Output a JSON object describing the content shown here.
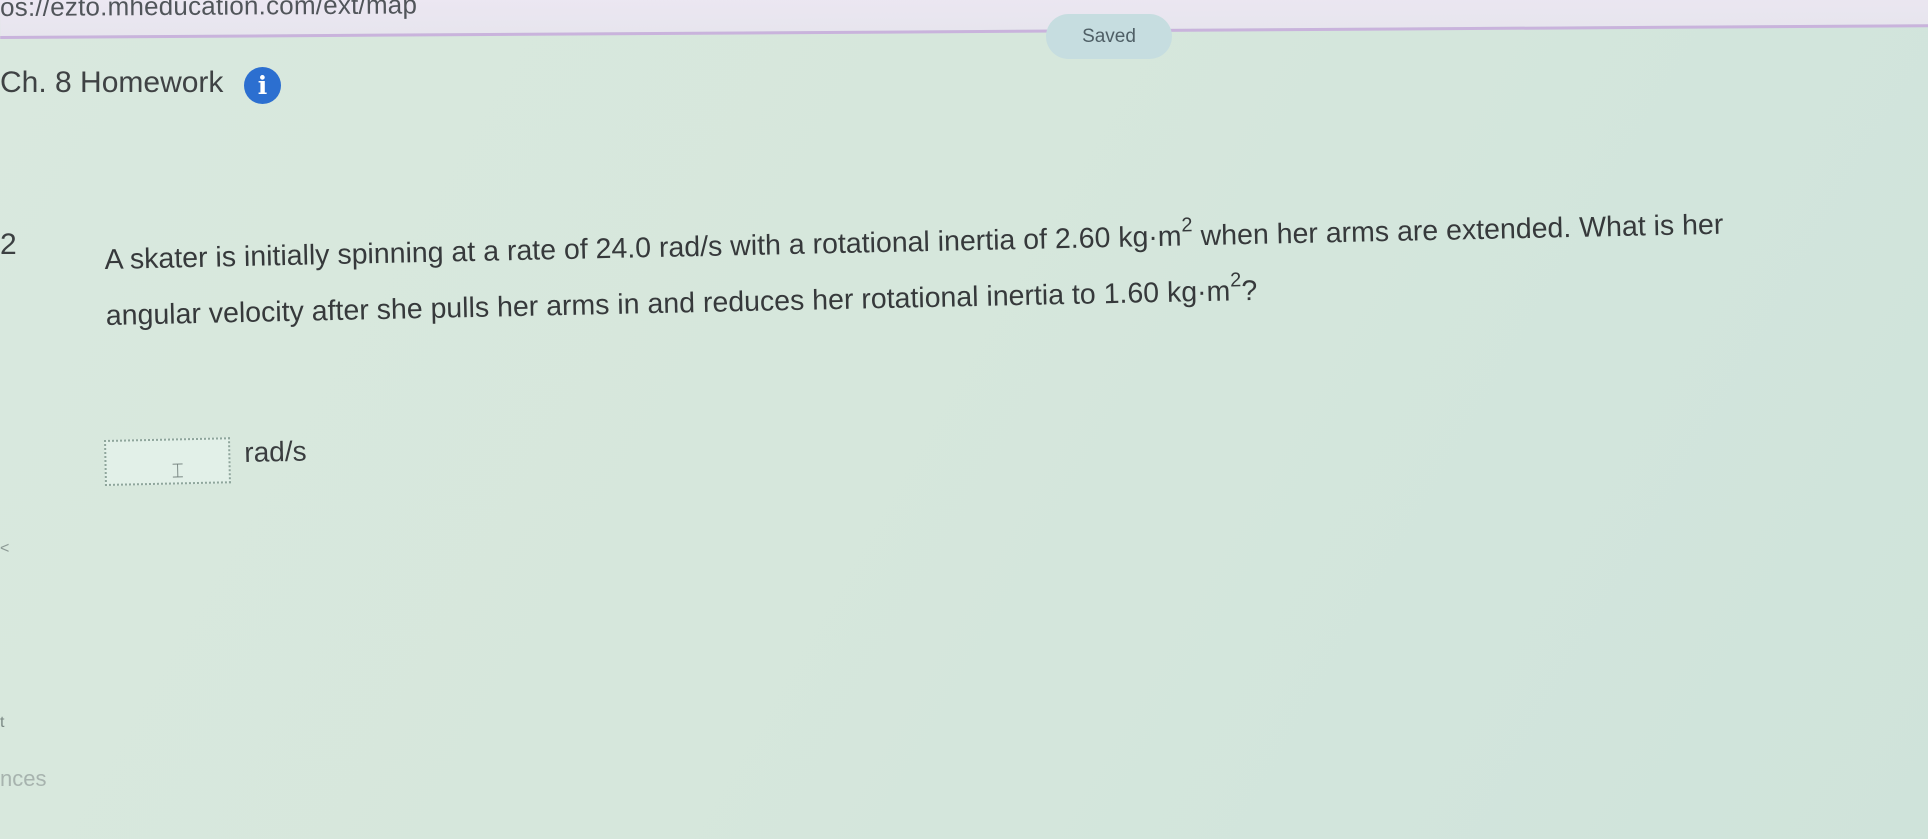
{
  "browser": {
    "url": "os://ezto.mheducation.com/ext/map"
  },
  "header": {
    "status_badge": "Saved",
    "assignment_title": "Ch. 8 Homework",
    "info_icon_glyph": "i"
  },
  "question": {
    "line1": {
      "prefix": "A skater is initially spinning at a rate of 24.0 rad/s with a rotational inertia of 2.60 kg·m",
      "exp": "2",
      "suffix": " when her arms are extended. What is her"
    },
    "line2": {
      "prefix": "angular velocity after she pulls her arms in and reduces her rotational inertia to 1.60 kg·m",
      "exp": "2",
      "suffix": "?"
    }
  },
  "answer": {
    "value": "",
    "unit": "rad/s",
    "cursor_icon": "text-cursor-icon"
  },
  "sidebar": {
    "partial_label": "nces"
  },
  "edge_marks": {
    "top": "2",
    "middle": "<",
    "bottom": "t"
  },
  "colors": {
    "accent": "#2c6fd0",
    "badge_bg": "#c6dde0",
    "background": "#d6e7dc"
  }
}
